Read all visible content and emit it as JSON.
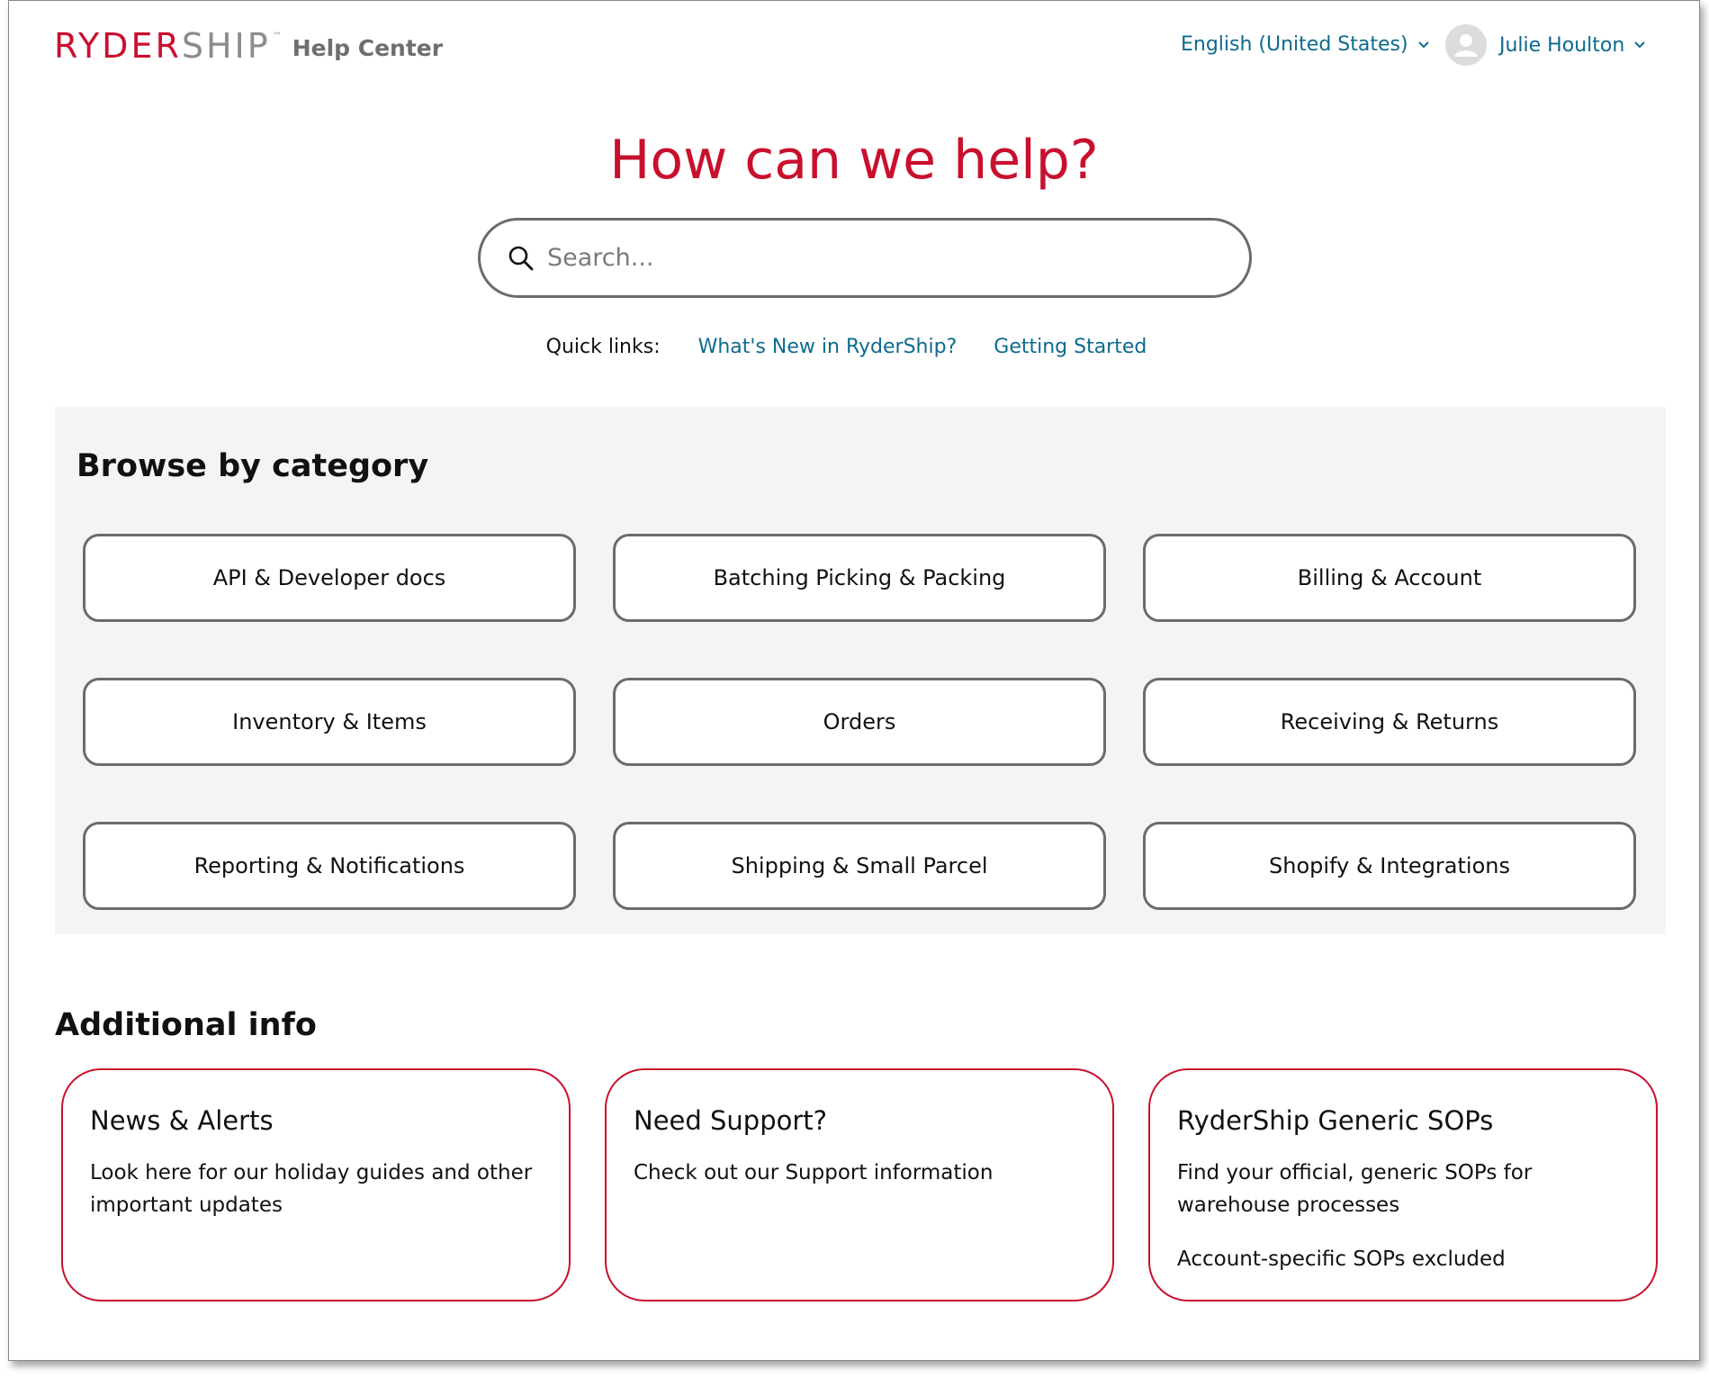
{
  "header": {
    "logo": {
      "brand_primary": "RYDER",
      "brand_secondary": "SHIP",
      "trademark": "™",
      "subtitle": "Help Center"
    },
    "language": {
      "label": "English (United States)",
      "icon": "chevron-down-icon"
    },
    "user": {
      "name": "Julie Houlton",
      "avatar_icon": "user-avatar-icon",
      "icon": "chevron-down-icon"
    }
  },
  "hero": {
    "title": "How can we help?",
    "search": {
      "placeholder": "Search...",
      "value": "",
      "icon": "search-icon"
    },
    "quick_links": {
      "label": "Quick links:",
      "links": [
        "What's New in RyderShip?",
        "Getting Started"
      ]
    }
  },
  "browse": {
    "title": "Browse by category",
    "categories": [
      "API & Developer docs",
      "Batching Picking & Packing",
      "Billing & Account",
      "Inventory & Items",
      "Orders",
      "Receiving & Returns",
      "Reporting & Notifications",
      "Shipping & Small Parcel",
      "Shopify & Integrations"
    ]
  },
  "additional": {
    "title": "Additional info",
    "cards": [
      {
        "title": "News & Alerts",
        "lines": [
          "Look here for our holiday guides and other important updates"
        ]
      },
      {
        "title": "Need Support?",
        "lines": [
          "Check out our Support information"
        ]
      },
      {
        "title": "RyderShip Generic SOPs",
        "lines": [
          "Find your official, generic SOPs for warehouse processes",
          "Account-specific SOPs excluded"
        ]
      }
    ]
  },
  "colors": {
    "brand_red": "#c8102e",
    "link_teal": "#0d6a8e",
    "panel_gray": "#f4f4f5",
    "border_gray": "#6b6b6b"
  }
}
